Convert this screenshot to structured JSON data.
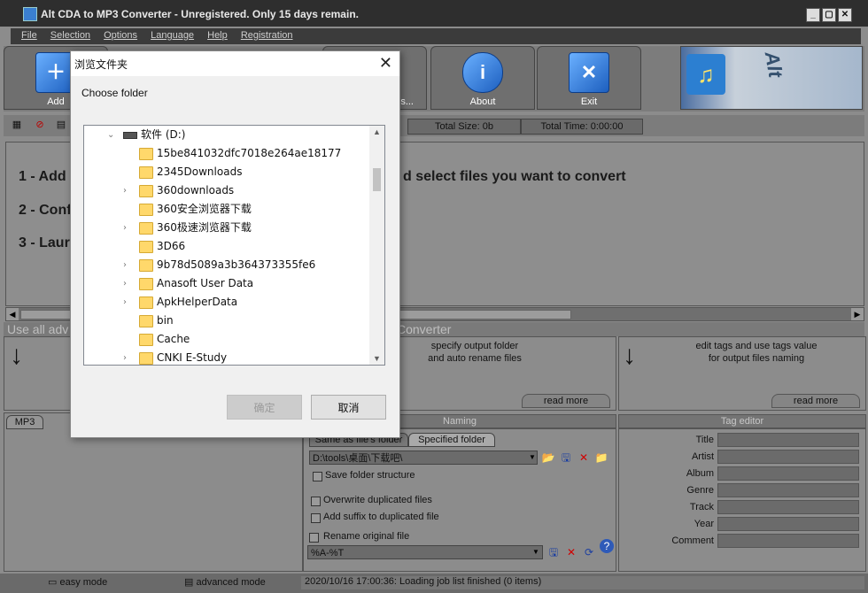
{
  "window": {
    "title": "Alt CDA to MP3 Converter - Unregistered. Only 15 days remain."
  },
  "menu": [
    "File",
    "Selection",
    "Options",
    "Language",
    "Help",
    "Registration"
  ],
  "toolbar": {
    "add_label": "Add",
    "settings_label": "gs...",
    "about_label": "About",
    "exit_label": "Exit"
  },
  "stats": {
    "total_size": "Total Size: 0b",
    "total_time": "Total Time: 0:00:00"
  },
  "steps": {
    "step1": "1 - Add",
    "step1_tail": "d select files you want to convert",
    "step2": "2 - Conf",
    "step3": "3 - Laur"
  },
  "advanced_hint": {
    "prefix": "Use all adv",
    "suffix": "Converter"
  },
  "panels": {
    "middle_text": "specify output folder\nand auto rename files",
    "right_text": "edit tags and use tags value\nfor output files naming",
    "read_more": "read more"
  },
  "format_tab": "MP3",
  "naming": {
    "header": "Naming",
    "tab_same": "Same as file's folder",
    "tab_specified": "Specified folder",
    "folder_value": "D:\\tools\\桌面\\下载吧\\",
    "save_structure": "Save folder structure",
    "overwrite": "Overwrite duplicated files",
    "add_suffix": "Add suffix to duplicated file",
    "rename_original": "Rename original file",
    "rename_pattern": "%A-%T"
  },
  "tag_editor": {
    "header": "Tag editor",
    "fields": [
      "Title",
      "Artist",
      "Album",
      "Genre",
      "Track",
      "Year",
      "Comment"
    ]
  },
  "bottom": {
    "easy_mode": "easy mode",
    "advanced_mode": "advanced mode",
    "status": "2020/10/16 17:00:36: Loading job list finished (0 items)"
  },
  "dialog": {
    "title": "浏览文件夹",
    "prompt": "Choose folder",
    "drive": "软件 (D:)",
    "folders": [
      {
        "name": "15be841032dfc7018e264ae18177",
        "expandable": false
      },
      {
        "name": "2345Downloads",
        "expandable": false
      },
      {
        "name": "360downloads",
        "expandable": true
      },
      {
        "name": "360安全浏览器下载",
        "expandable": false
      },
      {
        "name": "360极速浏览器下载",
        "expandable": true
      },
      {
        "name": "3D66",
        "expandable": false
      },
      {
        "name": "9b78d5089a3b364373355fe6",
        "expandable": true
      },
      {
        "name": "Anasoft User Data",
        "expandable": true
      },
      {
        "name": "ApkHelperData",
        "expandable": true
      },
      {
        "name": "bin",
        "expandable": false
      },
      {
        "name": "Cache",
        "expandable": false
      },
      {
        "name": "CNKI E-Study",
        "expandable": true
      }
    ],
    "ok_label": "确定",
    "cancel_label": "取消"
  }
}
